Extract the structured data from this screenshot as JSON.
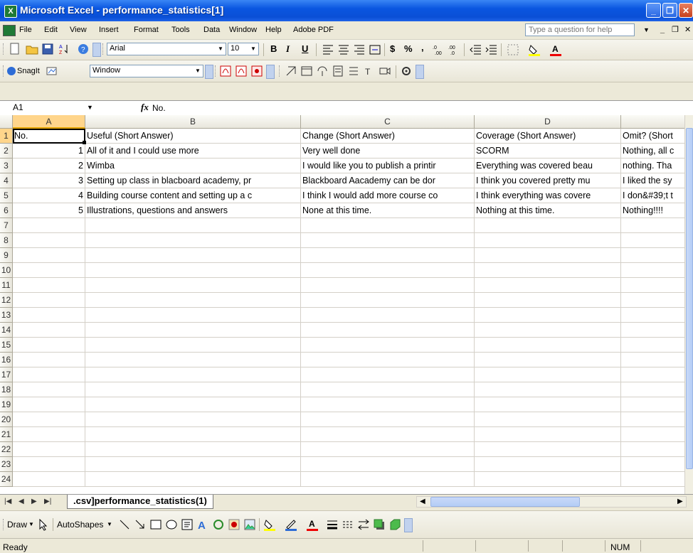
{
  "window": {
    "title": "Microsoft Excel - performance_statistics[1]"
  },
  "menu": {
    "items": [
      "File",
      "Edit",
      "View",
      "Insert",
      "Format",
      "Tools",
      "Data",
      "Window",
      "Help",
      "Adobe PDF"
    ],
    "help_placeholder": "Type a question for help"
  },
  "toolbar": {
    "font_name": "Arial",
    "font_size": "10",
    "bold": "B",
    "italic": "I",
    "underline": "U",
    "currency": "$",
    "percent": "%",
    "comma": ","
  },
  "snagit": {
    "label": "SnagIt",
    "capture_mode": "Window"
  },
  "formula_bar": {
    "cell_ref": "A1",
    "fx": "fx",
    "value": "No."
  },
  "grid": {
    "columns": [
      "A",
      "B",
      "C",
      "D"
    ],
    "row_numbers": [
      "1",
      "2",
      "3",
      "4",
      "5",
      "6",
      "7",
      "8",
      "9",
      "10",
      "11",
      "12",
      "13",
      "14",
      "15",
      "16",
      "17",
      "18",
      "19",
      "20",
      "21",
      "22",
      "23",
      "24"
    ],
    "rows": [
      [
        "No.",
        "Useful (Short Answer)",
        "Change (Short Answer)",
        "Coverage (Short Answer)",
        "Omit? (Short"
      ],
      [
        "1",
        "All of it and I could use more",
        "Very well done",
        "SCORM",
        "Nothing, all c"
      ],
      [
        "2",
        "Wimba",
        "I would like you to publish a printir",
        "Everything was covered beau",
        "nothing. Tha"
      ],
      [
        "3",
        "Setting up class in blacboard academy, pr",
        "Blackboard Aacademy can be dor",
        "I think you covered pretty mu",
        "I liked the sy"
      ],
      [
        "4",
        "Building course content and setting up a c",
        "I think I would add more course co",
        "I think everything was covere",
        "I don&#39;t t"
      ],
      [
        "5",
        "Illustrations, questions and answers",
        "None at this time.",
        "Nothing at this time.",
        "Nothing!!!!"
      ]
    ]
  },
  "sheet": {
    "tab_label": ".csv]performance_statistics(1)"
  },
  "draw_toolbar": {
    "draw_label": "Draw",
    "autoshapes_label": "AutoShapes"
  },
  "status": {
    "text": "Ready",
    "num": "NUM"
  },
  "colors": {
    "title_blue": "#0a56e0",
    "excel_green": "#1f7a36",
    "selection_orange": "#ffd58b"
  }
}
